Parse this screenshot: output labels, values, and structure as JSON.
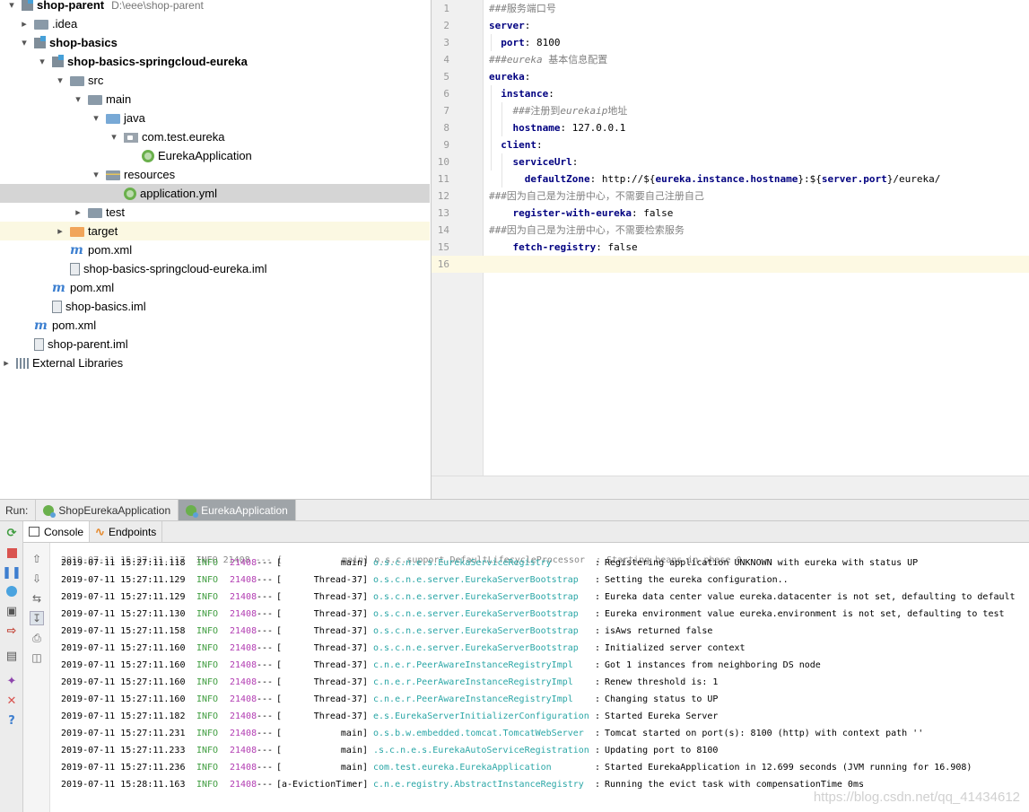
{
  "tree": {
    "project_name": "shop-parent",
    "project_path": "D:\\eee\\shop-parent",
    "items": [
      {
        "label": "shop-parent"
      },
      {
        "label": ".idea"
      },
      {
        "label": "shop-basics"
      },
      {
        "label": "shop-basics-springcloud-eureka"
      },
      {
        "label": "src"
      },
      {
        "label": "main"
      },
      {
        "label": "java"
      },
      {
        "label": "com.test.eureka"
      },
      {
        "label": "EurekaApplication"
      },
      {
        "label": "resources"
      },
      {
        "label": "application.yml"
      },
      {
        "label": "test"
      },
      {
        "label": "target"
      },
      {
        "label": "pom.xml"
      },
      {
        "label": "shop-basics-springcloud-eureka.iml"
      },
      {
        "label": "pom.xml"
      },
      {
        "label": "shop-basics.iml"
      },
      {
        "label": "pom.xml"
      },
      {
        "label": "shop-parent.iml"
      },
      {
        "label": "External Libraries"
      }
    ]
  },
  "editor": {
    "lines": [
      {
        "n": "1",
        "parts": [
          [
            "c",
            "###服务端口号"
          ]
        ]
      },
      {
        "n": "2",
        "parts": [
          [
            "k",
            "server"
          ],
          [
            "v",
            ":"
          ]
        ]
      },
      {
        "n": "3",
        "parts": [
          [
            "v",
            "  "
          ],
          [
            "k",
            "port"
          ],
          [
            "v",
            ": 8100"
          ]
        ]
      },
      {
        "n": "4",
        "parts": [
          [
            "c",
            "###"
          ],
          [
            "ci",
            "eureka"
          ],
          [
            "c",
            " 基本信息配置"
          ]
        ]
      },
      {
        "n": "5",
        "parts": [
          [
            "k",
            "eureka"
          ],
          [
            "v",
            ":"
          ]
        ]
      },
      {
        "n": "6",
        "parts": [
          [
            "v",
            "  "
          ],
          [
            "k",
            "instance"
          ],
          [
            "v",
            ":"
          ]
        ]
      },
      {
        "n": "7",
        "parts": [
          [
            "v",
            "    "
          ],
          [
            "c",
            "###注册到"
          ],
          [
            "ci",
            "eurekaip"
          ],
          [
            "c",
            "地址"
          ]
        ]
      },
      {
        "n": "8",
        "parts": [
          [
            "v",
            "    "
          ],
          [
            "k",
            "hostname"
          ],
          [
            "v",
            ": 127.0.0.1"
          ]
        ]
      },
      {
        "n": "9",
        "parts": [
          [
            "v",
            "  "
          ],
          [
            "k",
            "client"
          ],
          [
            "v",
            ":"
          ]
        ]
      },
      {
        "n": "10",
        "parts": [
          [
            "v",
            "    "
          ],
          [
            "k",
            "serviceUrl"
          ],
          [
            "v",
            ":"
          ]
        ]
      },
      {
        "n": "11",
        "parts": [
          [
            "v",
            "      "
          ],
          [
            "k",
            "defaultZone"
          ],
          [
            "v",
            ": http://${"
          ],
          [
            "k",
            "eureka.instance.hostname"
          ],
          [
            "v",
            "}:${"
          ],
          [
            "k",
            "server.port"
          ],
          [
            "v",
            "}/eureka/"
          ]
        ]
      },
      {
        "n": "12",
        "parts": [
          [
            "c",
            "###因为自己是为注册中心，不需要自己注册自己"
          ]
        ]
      },
      {
        "n": "13",
        "parts": [
          [
            "v",
            "    "
          ],
          [
            "k",
            "register-with-eureka"
          ],
          [
            "v",
            ": false"
          ]
        ]
      },
      {
        "n": "14",
        "parts": [
          [
            "c",
            "###因为自己是为注册中心，不需要检索服务"
          ]
        ]
      },
      {
        "n": "15",
        "parts": [
          [
            "v",
            "    "
          ],
          [
            "k",
            "fetch-registry"
          ],
          [
            "v",
            ": false"
          ]
        ]
      },
      {
        "n": "16",
        "parts": [
          [
            "v",
            ""
          ]
        ]
      }
    ]
  },
  "run": {
    "label": "Run:",
    "tabs": [
      "ShopEurekaApplication",
      "EurekaApplication"
    ],
    "console_tab": "Console",
    "endpoints_tab": "Endpoints"
  },
  "console": {
    "partial_line": "2019-07-11 15:27:11.117  INFO 21408 --- [           main] o.s.c.support.DefaultLifecycleProcessor  : Starting beans in phase 0",
    "rows": [
      {
        "ts": "2019-07-11 15:27:11.118",
        "lvl": "INFO",
        "pid": "21408",
        "thr": "main]",
        "lgr": "o.s.c.n.e.s.EurekaServiceRegistry",
        "msg": "Registering application UNKNOWN with eureka with status UP"
      },
      {
        "ts": "2019-07-11 15:27:11.129",
        "lvl": "INFO",
        "pid": "21408",
        "thr": "Thread-37]",
        "lgr": "o.s.c.n.e.server.EurekaServerBootstrap",
        "msg": "Setting the eureka configuration.."
      },
      {
        "ts": "2019-07-11 15:27:11.129",
        "lvl": "INFO",
        "pid": "21408",
        "thr": "Thread-37]",
        "lgr": "o.s.c.n.e.server.EurekaServerBootstrap",
        "msg": "Eureka data center value eureka.datacenter is not set, defaulting to default"
      },
      {
        "ts": "2019-07-11 15:27:11.130",
        "lvl": "INFO",
        "pid": "21408",
        "thr": "Thread-37]",
        "lgr": "o.s.c.n.e.server.EurekaServerBootstrap",
        "msg": "Eureka environment value eureka.environment is not set, defaulting to test"
      },
      {
        "ts": "2019-07-11 15:27:11.158",
        "lvl": "INFO",
        "pid": "21408",
        "thr": "Thread-37]",
        "lgr": "o.s.c.n.e.server.EurekaServerBootstrap",
        "msg": "isAws returned false"
      },
      {
        "ts": "2019-07-11 15:27:11.160",
        "lvl": "INFO",
        "pid": "21408",
        "thr": "Thread-37]",
        "lgr": "o.s.c.n.e.server.EurekaServerBootstrap",
        "msg": "Initialized server context"
      },
      {
        "ts": "2019-07-11 15:27:11.160",
        "lvl": "INFO",
        "pid": "21408",
        "thr": "Thread-37]",
        "lgr": "c.n.e.r.PeerAwareInstanceRegistryImpl",
        "msg": "Got 1 instances from neighboring DS node"
      },
      {
        "ts": "2019-07-11 15:27:11.160",
        "lvl": "INFO",
        "pid": "21408",
        "thr": "Thread-37]",
        "lgr": "c.n.e.r.PeerAwareInstanceRegistryImpl",
        "msg": "Renew threshold is: 1"
      },
      {
        "ts": "2019-07-11 15:27:11.160",
        "lvl": "INFO",
        "pid": "21408",
        "thr": "Thread-37]",
        "lgr": "c.n.e.r.PeerAwareInstanceRegistryImpl",
        "msg": "Changing status to UP"
      },
      {
        "ts": "2019-07-11 15:27:11.182",
        "lvl": "INFO",
        "pid": "21408",
        "thr": "Thread-37]",
        "lgr": "e.s.EurekaServerInitializerConfiguration",
        "msg": "Started Eureka Server"
      },
      {
        "ts": "2019-07-11 15:27:11.231",
        "lvl": "INFO",
        "pid": "21408",
        "thr": "main]",
        "lgr": "o.s.b.w.embedded.tomcat.TomcatWebServer",
        "msg": "Tomcat started on port(s): 8100 (http) with context path ''"
      },
      {
        "ts": "2019-07-11 15:27:11.233",
        "lvl": "INFO",
        "pid": "21408",
        "thr": "main]",
        "lgr": ".s.c.n.e.s.EurekaAutoServiceRegistration",
        "msg": "Updating port to 8100"
      },
      {
        "ts": "2019-07-11 15:27:11.236",
        "lvl": "INFO",
        "pid": "21408",
        "thr": "main]",
        "lgr": "com.test.eureka.EurekaApplication",
        "msg": "Started EurekaApplication in 12.699 seconds (JVM running for 16.908)"
      },
      {
        "ts": "2019-07-11 15:28:11.163",
        "lvl": "INFO",
        "pid": "21408",
        "thr": "[a-EvictionTimer]",
        "lgr": "c.n.e.registry.AbstractInstanceRegistry",
        "msg": "Running the evict task with compensationTime 0ms"
      }
    ],
    "separator": "---",
    "thread_open": "[",
    "colon": ":"
  },
  "watermark": "https://blog.csdn.net/qq_41434612"
}
